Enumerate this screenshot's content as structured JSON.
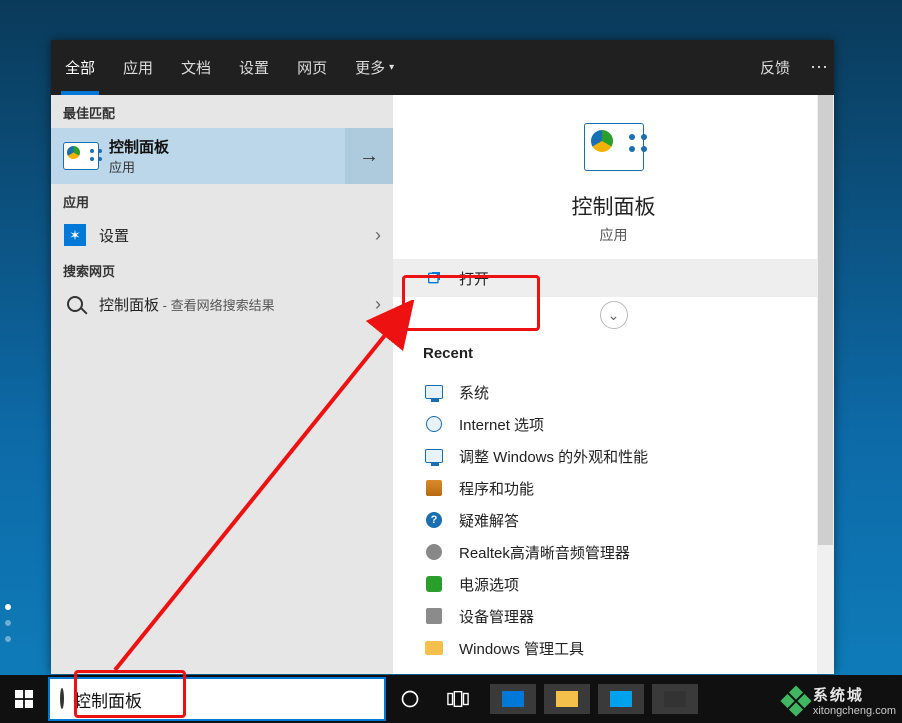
{
  "tabs": {
    "all": "全部",
    "apps": "应用",
    "docs": "文档",
    "settings": "设置",
    "web": "网页",
    "more": "更多",
    "feedback": "反馈"
  },
  "left": {
    "best_match_hdr": "最佳匹配",
    "best_match": {
      "title": "控制面板",
      "sub": "应用"
    },
    "apps_hdr": "应用",
    "app_item": "设置",
    "web_hdr": "搜索网页",
    "web_item": "控制面板",
    "web_item_sub": " - 查看网络搜索结果"
  },
  "right": {
    "title": "控制面板",
    "sub": "应用",
    "open": "打开",
    "recent_hdr": "Recent",
    "recent": [
      "系统",
      "Internet 选项",
      "调整 Windows 的外观和性能",
      "程序和功能",
      "疑难解答",
      "Realtek高清晰音频管理器",
      "电源选项",
      "设备管理器",
      "Windows 管理工具"
    ]
  },
  "search_value": "控制面板",
  "watermark": {
    "l1": "系统城",
    "l2": "xitongcheng.com"
  }
}
